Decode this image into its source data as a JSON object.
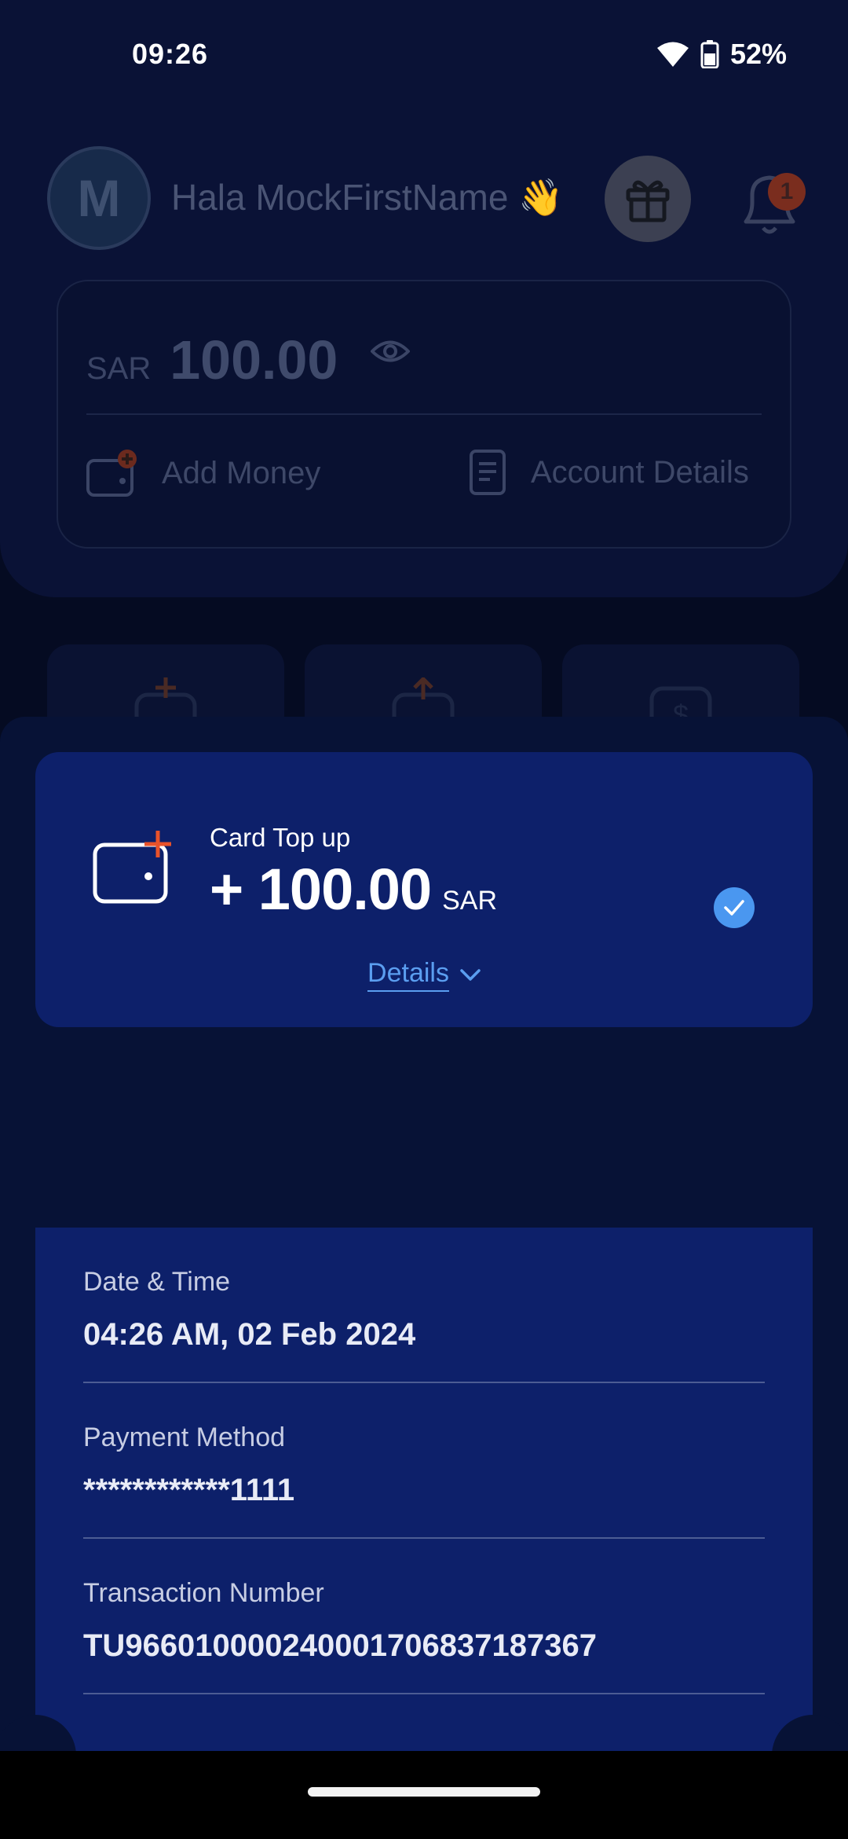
{
  "status_bar": {
    "time": "09:26",
    "battery": "52%",
    "icons": [
      "wifi-icon",
      "battery-icon"
    ]
  },
  "home": {
    "avatar_initial": "M",
    "greeting": "Hala MockFirstName 👋",
    "notification_count": "1",
    "balance": {
      "currency": "SAR",
      "amount": "100.00"
    },
    "actions": {
      "add_money": "Add Money",
      "account_details": "Account Details"
    }
  },
  "transaction": {
    "type": "Card Top up",
    "amount": "+ 100.00",
    "currency": "SAR",
    "status_icon": "check-icon",
    "details_label": "Details"
  },
  "details": [
    {
      "label": "Date & Time",
      "value": "04:26 AM, 02 Feb 2024"
    },
    {
      "label": "Payment Method",
      "value": "************1111"
    },
    {
      "label": "Transaction Number",
      "value": "TU966010000240001706837187367"
    }
  ],
  "colors": {
    "background": "#050b22",
    "card": "#0d206a",
    "accent_blue": "#4a97f0",
    "accent_orange": "#e8522a"
  }
}
